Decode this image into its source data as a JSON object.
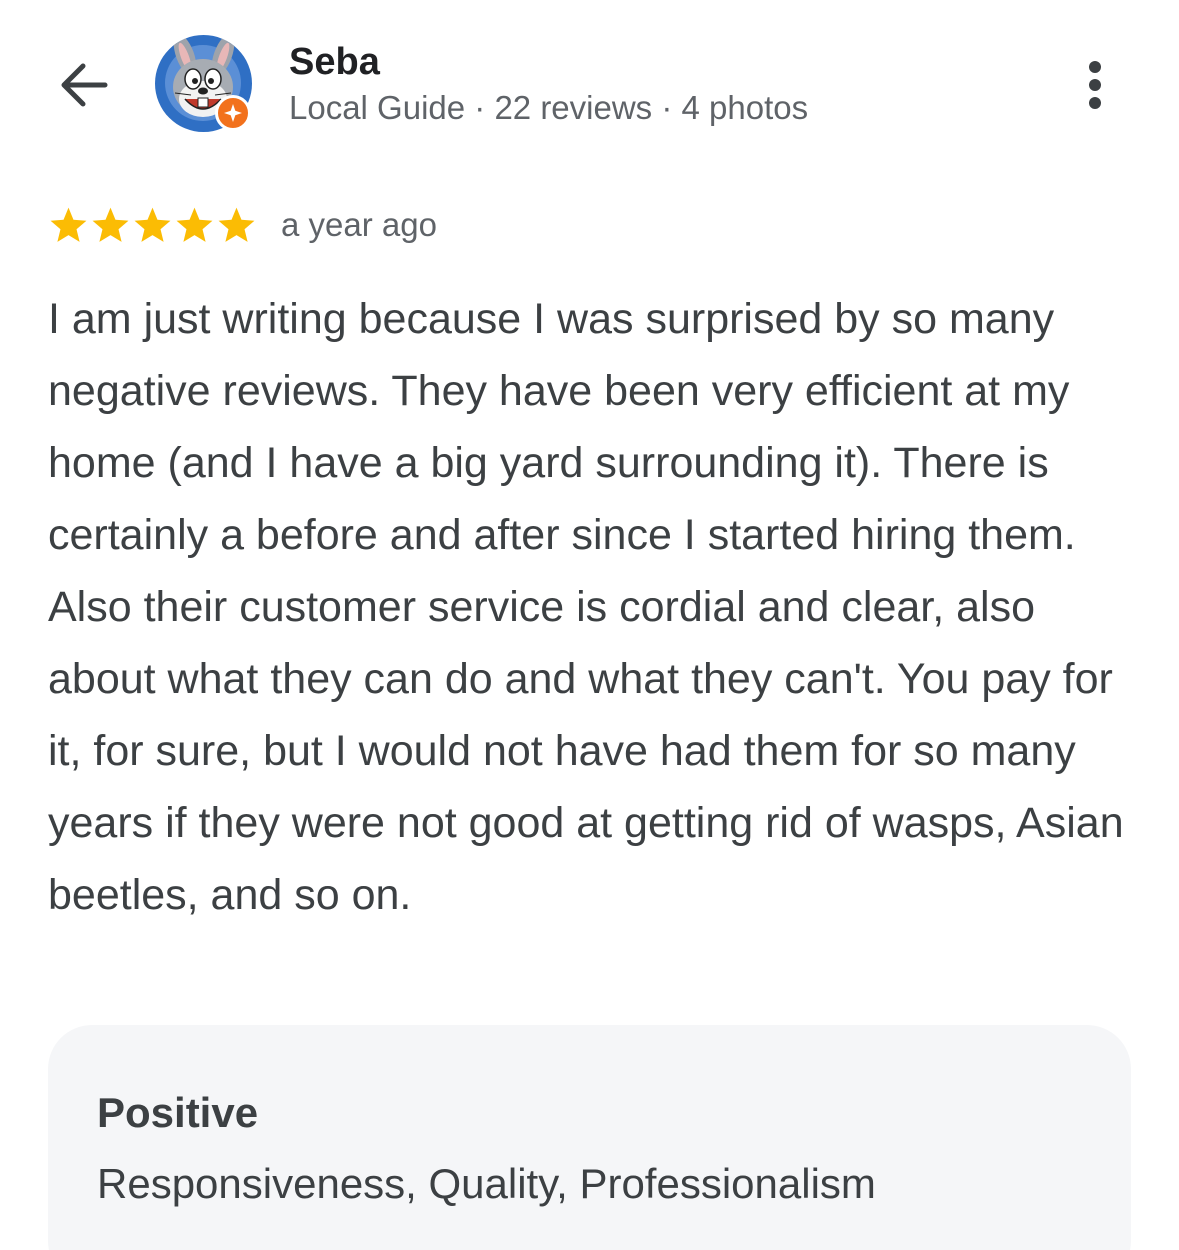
{
  "header": {
    "user_name": "Seba",
    "user_meta": "Local Guide · 22 reviews · 4 photos",
    "back_icon": "arrow-left-icon",
    "more_icon": "more-vert-icon",
    "avatar_icon": "cartoon-rabbit-avatar",
    "badge_icon": "local-guide-star-badge-icon"
  },
  "review": {
    "rating": 5,
    "rating_max": 5,
    "time_ago": "a year ago",
    "text": "I am just writing because I was surprised by so many negative reviews. They have been very efficient at my home (and I have a big yard surrounding it). There is certainly a before and after since I started hiring them. Also their customer service is cordial and clear, also about what they can do and what they can't. You pay for it, for sure, but I would not have had them for so many years if they were not good at getting rid of wasps, Asian beetles, and so on."
  },
  "highlights": {
    "title": "Positive",
    "value": "Responsiveness, Quality, Professionalism"
  },
  "colors": {
    "star": "#fbbc04",
    "badge": "#f2711c",
    "highlights_bg": "#f5f6f8",
    "text": "#3c4043",
    "meta": "#5f6368"
  }
}
